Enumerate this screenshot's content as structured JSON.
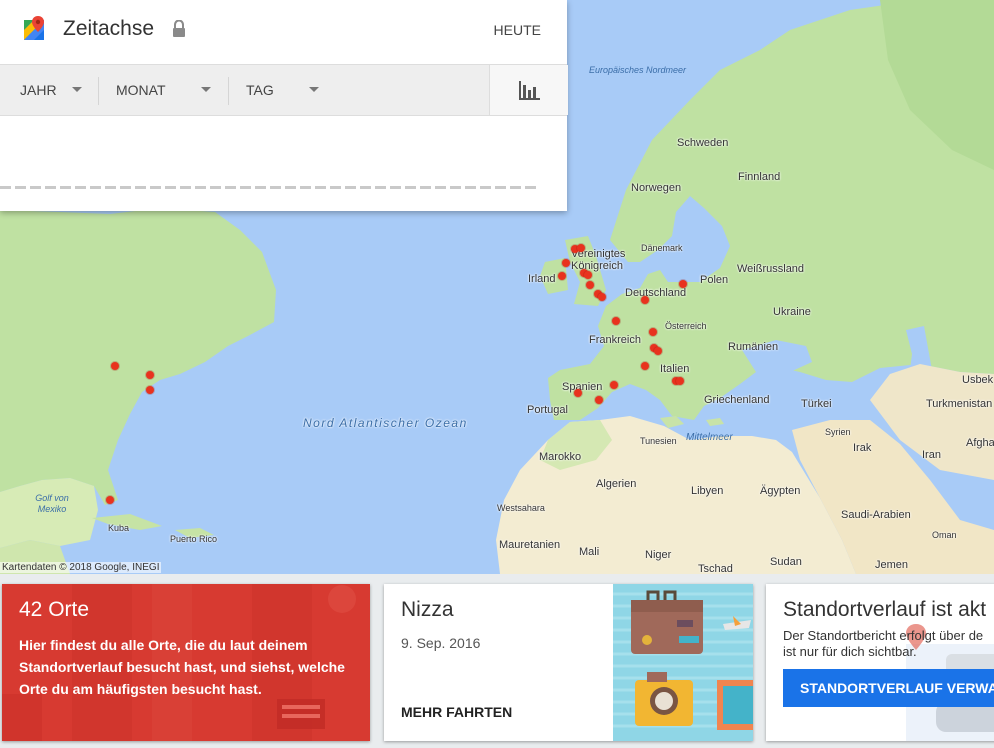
{
  "app": {
    "title": "Zeitachse",
    "today_label": "HEUTE",
    "icons": [
      "google-maps-logo-icon",
      "lock-icon",
      "chevron-down-icon",
      "bar-chart-icon",
      "map-pin-icon"
    ]
  },
  "filters": [
    {
      "label": "JAHR",
      "value": ""
    },
    {
      "label": "MONAT",
      "value": ""
    },
    {
      "label": "TAG",
      "value": ""
    }
  ],
  "map": {
    "attribution": "Kartendaten © 2018 Google, INEGI",
    "pin_color": "#e8321e",
    "labels": {
      "europaeisches_nordmeer": "Europäisches Nordmeer",
      "schweden": "Schweden",
      "finnland": "Finnland",
      "norwegen": "Norwegen",
      "daenemark": "Dänemark",
      "vereinigtes_koenigreich": "Vereinigtes Königreich",
      "irland": "Irland",
      "weissrussland": "Weißrussland",
      "polen": "Polen",
      "deutschland": "Deutschland",
      "ukraine": "Ukraine",
      "oesterreich": "Österreich",
      "frankreich": "Frankreich",
      "rumaenien": "Rumänien",
      "italien": "Italien",
      "spanien": "Spanien",
      "portugal": "Portugal",
      "griechenland": "Griechenland",
      "tuerkei": "Türkei",
      "usbek": "Usbek",
      "turkmenistan": "Turkmenistan",
      "syrien": "Syrien",
      "afgha": "Afgha",
      "irak": "Irak",
      "iran": "Iran",
      "tunesien": "Tunesien",
      "mittelmeer": "Mittelmeer",
      "marokko": "Marokko",
      "algerien": "Algerien",
      "libyen": "Libyen",
      "aegypten": "Ägypten",
      "saudi_arabien": "Saudi-Arabien",
      "oman": "Oman",
      "westsahara": "Westsahara",
      "mauretanien": "Mauretanien",
      "mali": "Mali",
      "niger": "Niger",
      "sudan": "Sudan",
      "tschad": "Tschad",
      "jemen": "Jemen",
      "nord_atlantischer_ozean": "Nord Atlantischer Ozean",
      "golf_von_mexiko": "Golf von Mexiko",
      "kuba": "Kuba",
      "puerto_rico": "Puerto Rico"
    }
  },
  "cards": {
    "places": {
      "count_label": "42 Orte",
      "description": "Hier findest du alle Orte, die du laut deinem Standortverlauf besucht hast, und siehst, welche Orte du am häufigsten besucht hast.",
      "color": "#d73a31"
    },
    "trip": {
      "city": "Nizza",
      "date": "9. Sep. 2016",
      "more_label": "MEHR FAHRTEN"
    },
    "history": {
      "title": "Standortverlauf ist akt",
      "description_line1": "Der Standortbericht erfolgt über de",
      "description_line2": "ist nur für dich sichtbar.",
      "button_label": "STANDORTVERLAUF VERWA",
      "button_color": "#1a73e8"
    }
  }
}
